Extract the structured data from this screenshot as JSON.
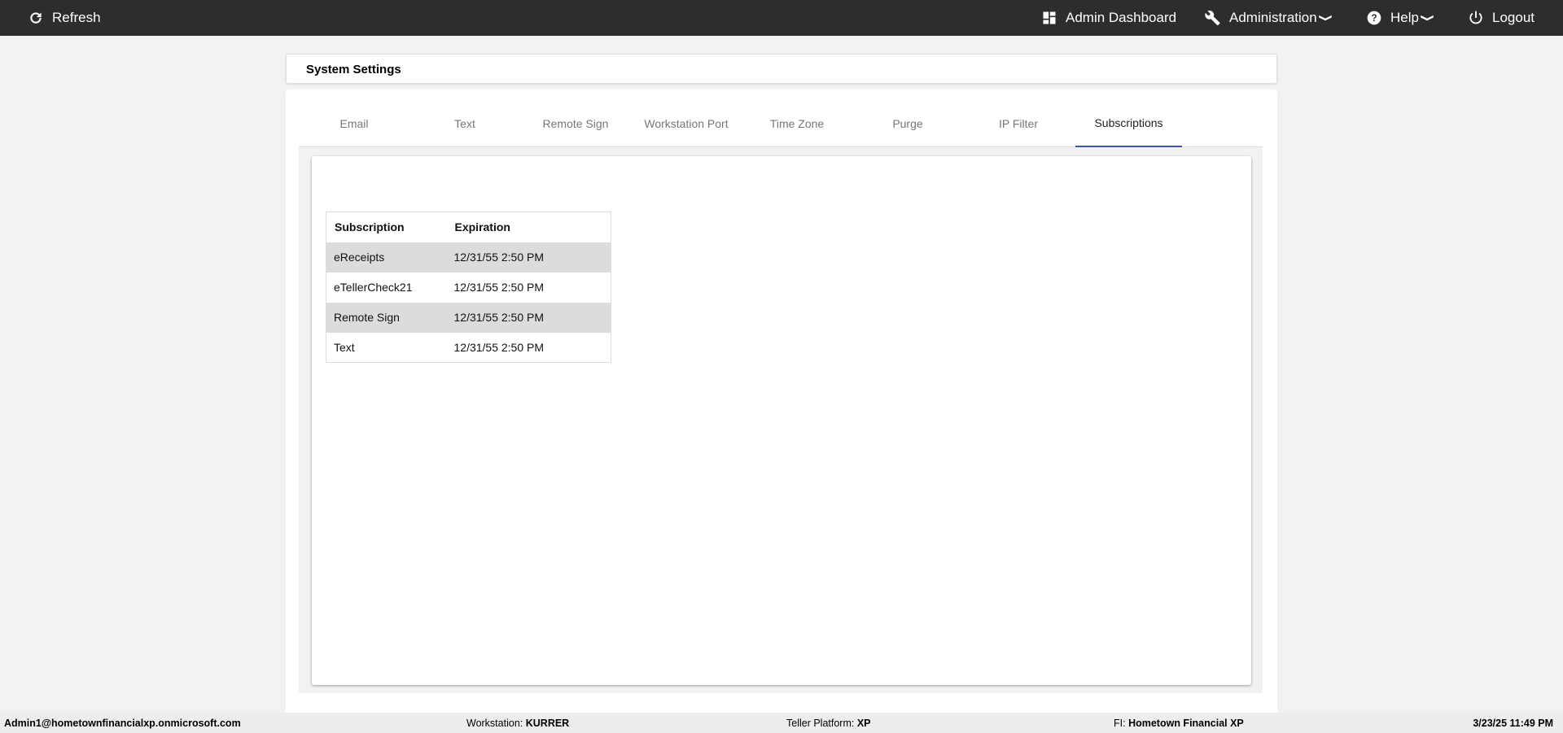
{
  "topbar": {
    "refresh": "Refresh",
    "admin_dashboard": "Admin Dashboard",
    "administration": "Administration",
    "help": "Help",
    "logout": "Logout"
  },
  "page_title": "System Settings",
  "tabs": [
    {
      "label": "Email"
    },
    {
      "label": "Text"
    },
    {
      "label": "Remote Sign"
    },
    {
      "label": "Workstation Port"
    },
    {
      "label": "Time Zone"
    },
    {
      "label": "Purge"
    },
    {
      "label": "IP Filter"
    },
    {
      "label": "Subscriptions",
      "active": true
    }
  ],
  "table": {
    "headers": [
      "Subscription",
      "Expiration"
    ],
    "rows": [
      [
        "eReceipts",
        "12/31/55 2:50 PM"
      ],
      [
        "eTellerCheck21",
        "12/31/55 2:50 PM"
      ],
      [
        "Remote Sign",
        "12/31/55 2:50 PM"
      ],
      [
        "Text",
        "12/31/55 2:50 PM"
      ]
    ]
  },
  "footer": {
    "user": "Admin1@hometownfinancialxp.onmicrosoft.com",
    "workstation_label": "Workstation:",
    "workstation": "KURRER",
    "platform_label": "Teller Platform:",
    "platform": "XP",
    "fi_label": "FI:",
    "fi": "Hometown Financial XP",
    "datetime": "3/23/25 11:49 PM"
  },
  "colors": {
    "topbar": "#2d2d2d",
    "accent": "#3f51b5"
  }
}
